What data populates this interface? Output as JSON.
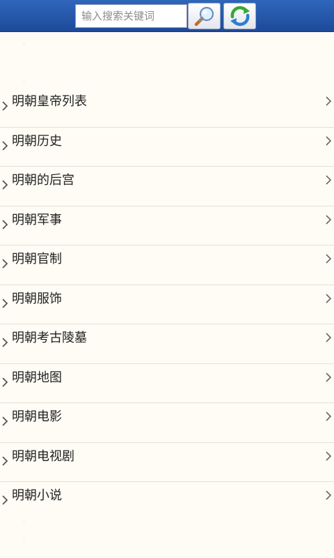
{
  "search": {
    "placeholder": "输入搜索关键词",
    "value": ""
  },
  "toolbar": {
    "search_icon": "magnifier-icon",
    "refresh_icon": "refresh-icon"
  },
  "colors": {
    "header": "#2f66bb",
    "background": "#fefcf4",
    "refresh_green": "#3aa832",
    "refresh_blue": "#2b7fd2"
  },
  "list": {
    "items": [
      {
        "label": "明朝皇帝列表"
      },
      {
        "label": "明朝历史"
      },
      {
        "label": "明朝的后宫"
      },
      {
        "label": "明朝军事"
      },
      {
        "label": "明朝官制"
      },
      {
        "label": "明朝服饰"
      },
      {
        "label": "明朝考古陵墓"
      },
      {
        "label": "明朝地图"
      },
      {
        "label": "明朝电影"
      },
      {
        "label": "明朝电视剧"
      },
      {
        "label": "明朝小说"
      }
    ]
  }
}
